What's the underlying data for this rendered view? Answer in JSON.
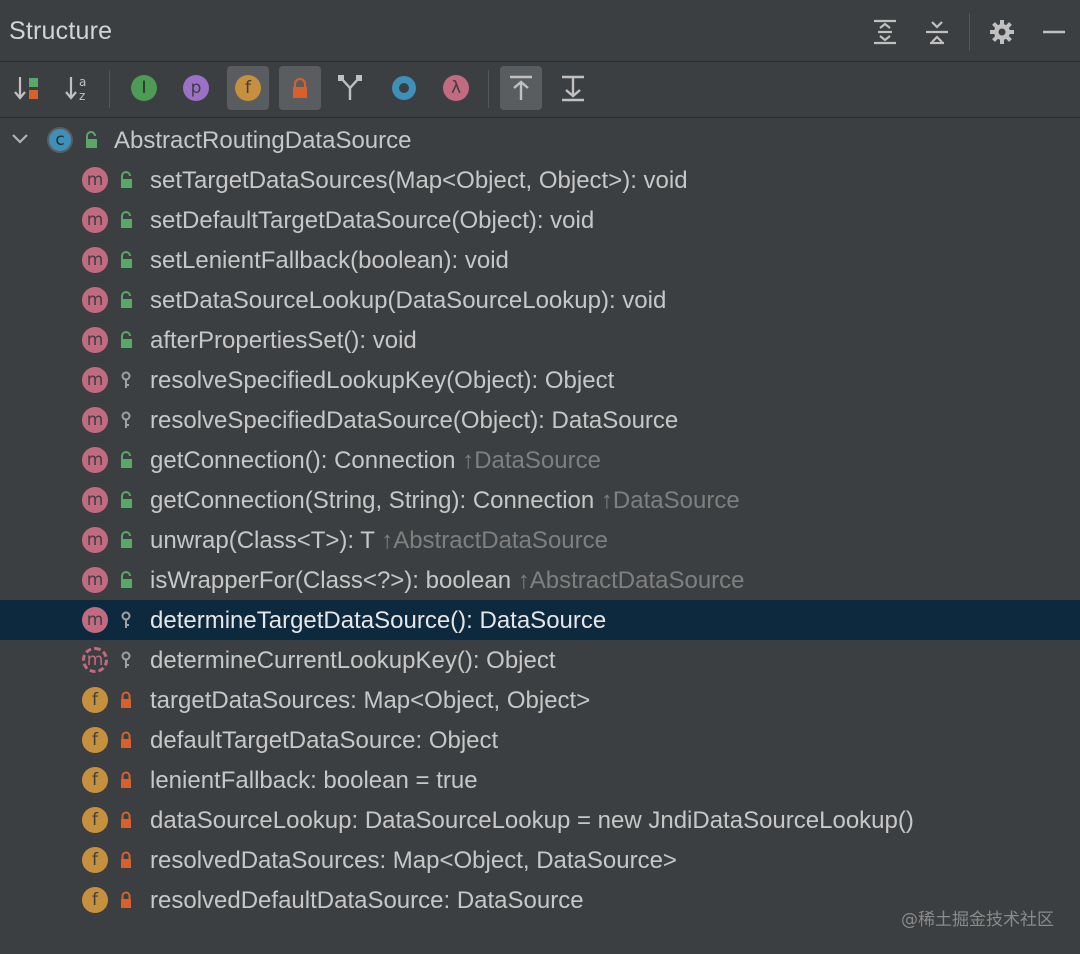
{
  "panel": {
    "title": "Structure"
  },
  "toolbar": {
    "buttons": [
      {
        "name": "sort-by-visibility-icon",
        "active": false
      },
      {
        "name": "sort-alphabetically-icon",
        "active": false
      },
      {
        "name": "show-inherited-interfaces-icon",
        "active": false
      },
      {
        "name": "show-properties-icon",
        "active": false
      },
      {
        "name": "show-fields-icon",
        "active": true
      },
      {
        "name": "show-non-public-icon",
        "active": true
      },
      {
        "name": "show-inherited-icon",
        "active": false
      },
      {
        "name": "show-anonymous-classes-icon",
        "active": false
      },
      {
        "name": "show-lambdas-icon",
        "active": false
      },
      {
        "name": "autoscroll-to-source-icon",
        "active": true
      },
      {
        "name": "autoscroll-from-source-icon",
        "active": false
      }
    ],
    "labels": {
      "p": "p",
      "f": "f",
      "i": "I",
      "lambda": "λ",
      "sortA": "a",
      "sortZ": "z"
    }
  },
  "tree": {
    "root": {
      "badge": "c",
      "label": "AbstractRoutingDataSource"
    },
    "items": [
      {
        "kind": "m",
        "vis": "public",
        "label": "setTargetDataSources(Map<Object, Object>): void",
        "inherited": ""
      },
      {
        "kind": "m",
        "vis": "public",
        "label": "setDefaultTargetDataSource(Object): void",
        "inherited": ""
      },
      {
        "kind": "m",
        "vis": "public",
        "label": "setLenientFallback(boolean): void",
        "inherited": ""
      },
      {
        "kind": "m",
        "vis": "public",
        "label": "setDataSourceLookup(DataSourceLookup): void",
        "inherited": ""
      },
      {
        "kind": "m",
        "vis": "public",
        "label": "afterPropertiesSet(): void",
        "inherited": ""
      },
      {
        "kind": "m",
        "vis": "protected",
        "label": "resolveSpecifiedLookupKey(Object): Object",
        "inherited": ""
      },
      {
        "kind": "m",
        "vis": "protected",
        "label": "resolveSpecifiedDataSource(Object): DataSource",
        "inherited": ""
      },
      {
        "kind": "m",
        "vis": "public",
        "label": "getConnection(): Connection",
        "inherited": "↑DataSource"
      },
      {
        "kind": "m",
        "vis": "public",
        "label": "getConnection(String, String): Connection",
        "inherited": "↑DataSource"
      },
      {
        "kind": "m",
        "vis": "public",
        "label": "unwrap(Class<T>): T",
        "inherited": "↑AbstractDataSource"
      },
      {
        "kind": "m",
        "vis": "public",
        "label": "isWrapperFor(Class<?>): boolean",
        "inherited": "↑AbstractDataSource"
      },
      {
        "kind": "m",
        "vis": "protected",
        "label": "determineTargetDataSource(): DataSource",
        "inherited": "",
        "selected": true
      },
      {
        "kind": "am",
        "vis": "protected",
        "label": "determineCurrentLookupKey(): Object",
        "inherited": ""
      },
      {
        "kind": "f",
        "vis": "private",
        "label": "targetDataSources: Map<Object, Object>",
        "inherited": ""
      },
      {
        "kind": "f",
        "vis": "private",
        "label": "defaultTargetDataSource: Object",
        "inherited": ""
      },
      {
        "kind": "f",
        "vis": "private",
        "label": "lenientFallback: boolean = true",
        "inherited": ""
      },
      {
        "kind": "f",
        "vis": "private",
        "label": "dataSourceLookup: DataSourceLookup = new JndiDataSourceLookup()",
        "inherited": ""
      },
      {
        "kind": "f",
        "vis": "private",
        "label": "resolvedDataSources: Map<Object, DataSource>",
        "inherited": ""
      },
      {
        "kind": "f",
        "vis": "private",
        "label": "resolvedDefaultDataSource: DataSource",
        "inherited": ""
      }
    ]
  },
  "watermark": "@稀土掘金技术社区",
  "colors": {
    "background": "#3c3f41",
    "selection": "#0d293e",
    "method": "#c26b80",
    "field": "#c6903e",
    "class": "#3d90b8",
    "public": "#59a869",
    "private": "#d8602d",
    "protected": "#a0a0a0"
  }
}
